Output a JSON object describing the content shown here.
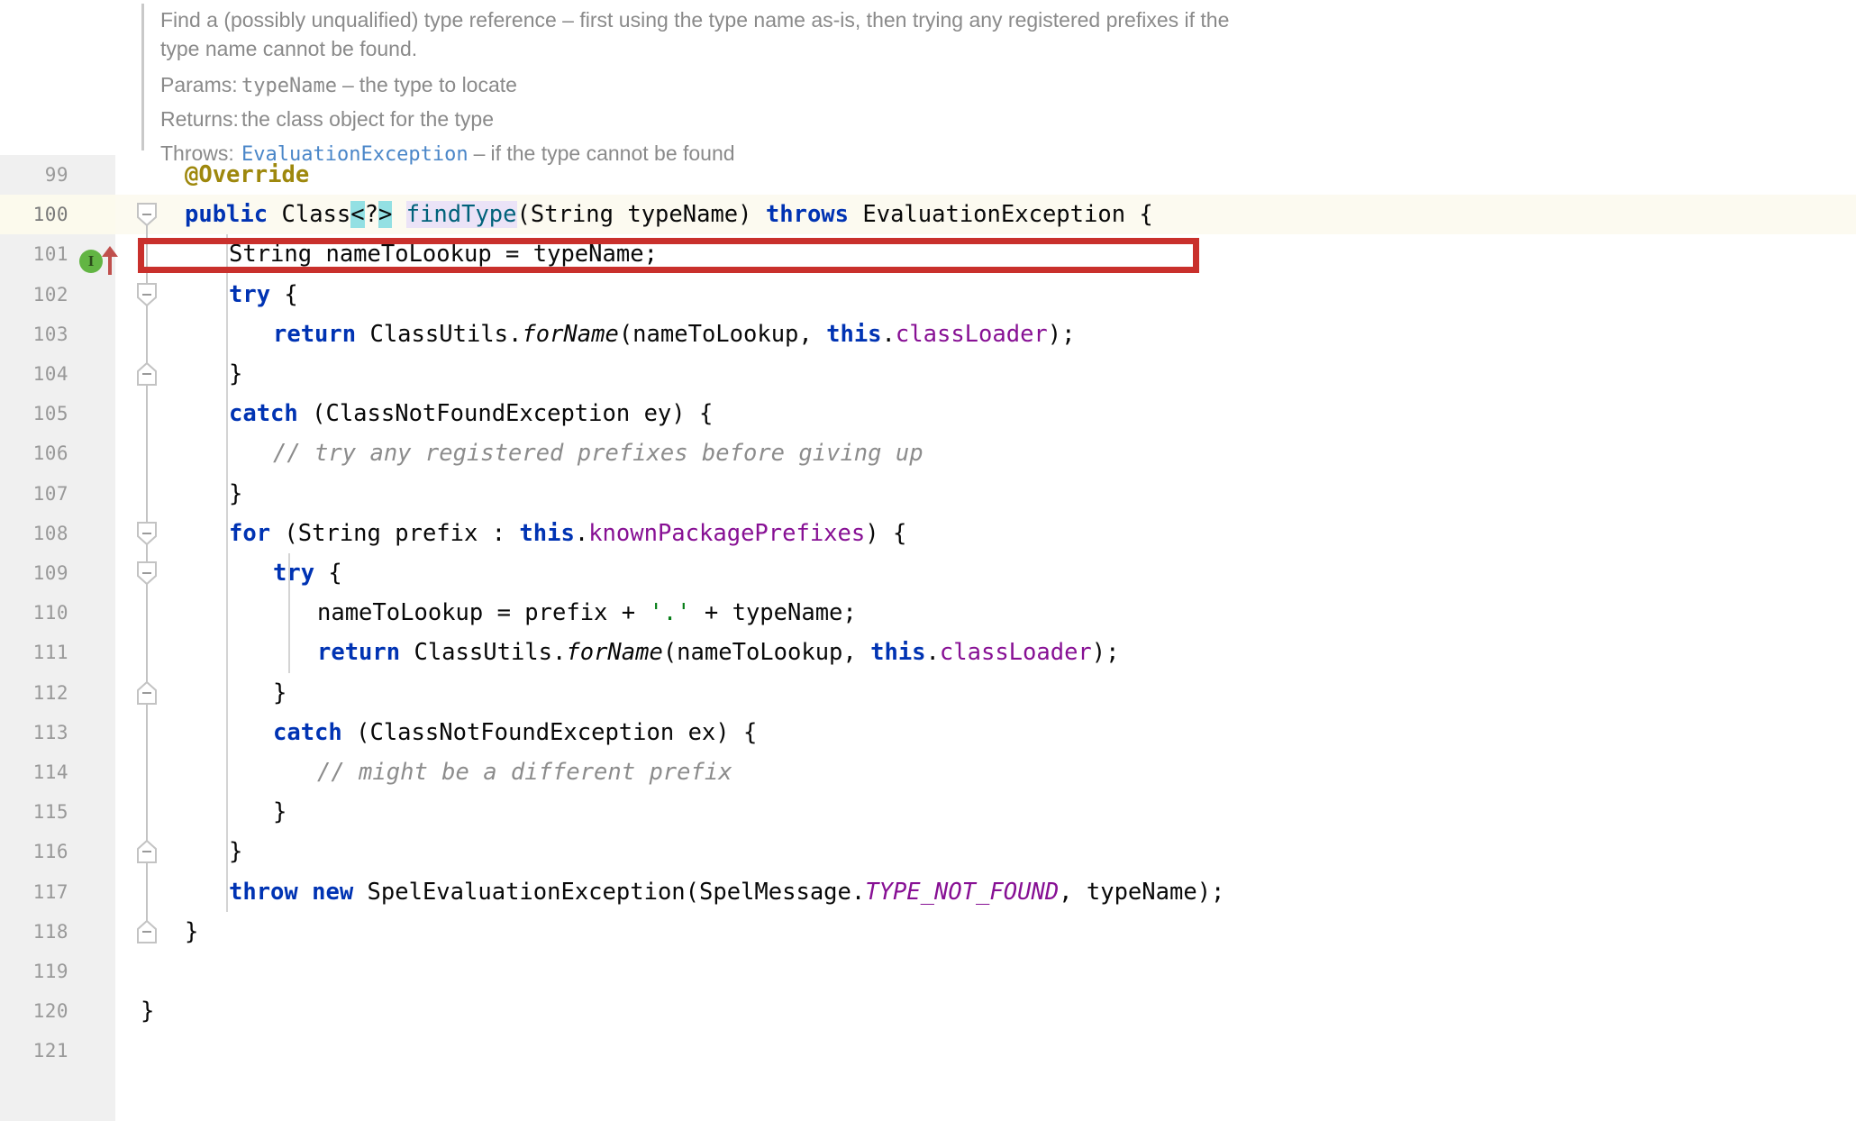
{
  "editor": {
    "language": "java",
    "font_size_px": 25.5,
    "colors": {
      "gutter_bg": "#f0f0f0",
      "editor_bg": "#ffffff",
      "caret_line_bg": "#fcfaf0",
      "keyword": "#0033b3",
      "annotation": "#9e880d",
      "field": "#871094",
      "static_field": "#871094",
      "method_decl": "#00627a",
      "string": "#067d17",
      "comment": "#8c8c8c",
      "identifier_highlight": "#ebe3f7",
      "brace_match_highlight": "#93e0e3",
      "annotation_box_border": "#c9302c",
      "javadoc_text": "#8a8a8a",
      "javadoc_link": "#4a86c8",
      "override_marker": "#62b543",
      "up_arrow": "#c0504d"
    }
  },
  "javadoc": {
    "description": "Find a (possibly unqualified) type reference – first using the type name as-is, then trying any registered prefixes if the type name cannot be found.",
    "params_label": "Params:",
    "param_name": "typeName",
    "param_dash": "–",
    "param_desc": "the type to locate",
    "returns_label": "Returns:",
    "returns_desc": "the class object for the type",
    "throws_label": "Throws:",
    "throws_type": "EvaluationException",
    "throws_dash": "–",
    "throws_desc": "if the type cannot be found"
  },
  "gutter": {
    "markers": {
      "override_icon_letter": "I",
      "override_icon_name": "implementing-method-marker",
      "up_arrow_name": "method-up-arrow-marker"
    }
  },
  "annotation_box": {
    "target_line": "100",
    "label": "highlighted-method-signature"
  },
  "code_lines": [
    {
      "num": "99",
      "indent": 1,
      "tokens": [
        {
          "t": "@Override",
          "c": "anno"
        }
      ]
    },
    {
      "num": "100",
      "indent": 1,
      "caret": true,
      "tokens": [
        {
          "t": "public",
          "c": "kw"
        },
        {
          "t": " ",
          "c": "plain"
        },
        {
          "t": "Class",
          "c": "plain"
        },
        {
          "t": "<",
          "c": "brace-hl"
        },
        {
          "t": "?",
          "c": "plain"
        },
        {
          "t": ">",
          "c": "brace-hl"
        },
        {
          "t": " ",
          "c": "plain"
        },
        {
          "t": "findType",
          "c": "method-i ident-hl"
        },
        {
          "t": "(",
          "c": "plain"
        },
        {
          "t": "String typeName",
          "c": "plain"
        },
        {
          "t": ") ",
          "c": "plain"
        },
        {
          "t": "throws",
          "c": "kw"
        },
        {
          "t": " EvaluationException {",
          "c": "plain"
        }
      ]
    },
    {
      "num": "101",
      "indent": 2,
      "tokens": [
        {
          "t": "String nameToLookup = typeName;",
          "c": "plain"
        }
      ]
    },
    {
      "num": "102",
      "indent": 2,
      "tokens": [
        {
          "t": "try",
          "c": "kw"
        },
        {
          "t": " {",
          "c": "plain"
        }
      ]
    },
    {
      "num": "103",
      "indent": 3,
      "tokens": [
        {
          "t": "return",
          "c": "kw"
        },
        {
          "t": " ClassUtils.",
          "c": "plain"
        },
        {
          "t": "forName",
          "c": "static-m"
        },
        {
          "t": "(nameToLookup, ",
          "c": "plain"
        },
        {
          "t": "this",
          "c": "kw"
        },
        {
          "t": ".",
          "c": "plain"
        },
        {
          "t": "classLoader",
          "c": "field"
        },
        {
          "t": ");",
          "c": "plain"
        }
      ]
    },
    {
      "num": "104",
      "indent": 2,
      "tokens": [
        {
          "t": "}",
          "c": "plain"
        }
      ]
    },
    {
      "num": "105",
      "indent": 2,
      "tokens": [
        {
          "t": "catch",
          "c": "kw"
        },
        {
          "t": " (ClassNotFoundException ey) {",
          "c": "plain"
        }
      ]
    },
    {
      "num": "106",
      "indent": 3,
      "tokens": [
        {
          "t": "// try any registered prefixes before giving up",
          "c": "cmt"
        }
      ]
    },
    {
      "num": "107",
      "indent": 2,
      "tokens": [
        {
          "t": "}",
          "c": "plain"
        }
      ]
    },
    {
      "num": "108",
      "indent": 2,
      "tokens": [
        {
          "t": "for",
          "c": "kw"
        },
        {
          "t": " (String prefix : ",
          "c": "plain"
        },
        {
          "t": "this",
          "c": "kw"
        },
        {
          "t": ".",
          "c": "plain"
        },
        {
          "t": "knownPackagePrefixes",
          "c": "field"
        },
        {
          "t": ") {",
          "c": "plain"
        }
      ]
    },
    {
      "num": "109",
      "indent": 3,
      "tokens": [
        {
          "t": "try",
          "c": "kw"
        },
        {
          "t": " {",
          "c": "plain"
        }
      ]
    },
    {
      "num": "110",
      "indent": 4,
      "tokens": [
        {
          "t": "nameToLookup = prefix + ",
          "c": "plain"
        },
        {
          "t": "'.'",
          "c": "str"
        },
        {
          "t": " + typeName;",
          "c": "plain"
        }
      ]
    },
    {
      "num": "111",
      "indent": 4,
      "tokens": [
        {
          "t": "return",
          "c": "kw"
        },
        {
          "t": " ClassUtils.",
          "c": "plain"
        },
        {
          "t": "forName",
          "c": "static-m"
        },
        {
          "t": "(nameToLookup, ",
          "c": "plain"
        },
        {
          "t": "this",
          "c": "kw"
        },
        {
          "t": ".",
          "c": "plain"
        },
        {
          "t": "classLoader",
          "c": "field"
        },
        {
          "t": ");",
          "c": "plain"
        }
      ]
    },
    {
      "num": "112",
      "indent": 3,
      "tokens": [
        {
          "t": "}",
          "c": "plain"
        }
      ]
    },
    {
      "num": "113",
      "indent": 3,
      "tokens": [
        {
          "t": "catch",
          "c": "kw"
        },
        {
          "t": " (ClassNotFoundException ex) {",
          "c": "plain"
        }
      ]
    },
    {
      "num": "114",
      "indent": 4,
      "tokens": [
        {
          "t": "// might be a different prefix",
          "c": "cmt"
        }
      ]
    },
    {
      "num": "115",
      "indent": 3,
      "tokens": [
        {
          "t": "}",
          "c": "plain"
        }
      ]
    },
    {
      "num": "116",
      "indent": 2,
      "tokens": [
        {
          "t": "}",
          "c": "plain"
        }
      ]
    },
    {
      "num": "117",
      "indent": 2,
      "tokens": [
        {
          "t": "throw",
          "c": "kw"
        },
        {
          "t": " ",
          "c": "plain"
        },
        {
          "t": "new",
          "c": "kw"
        },
        {
          "t": " SpelEvaluationException(SpelMessage.",
          "c": "plain"
        },
        {
          "t": "TYPE_NOT_FOUND",
          "c": "static-f"
        },
        {
          "t": ", typeName);",
          "c": "plain"
        }
      ]
    },
    {
      "num": "118",
      "indent": 1,
      "tokens": [
        {
          "t": "}",
          "c": "plain"
        }
      ]
    },
    {
      "num": "119",
      "indent": 0,
      "tokens": []
    },
    {
      "num": "120",
      "indent": 0,
      "tokens": [
        {
          "t": "}",
          "c": "plain"
        }
      ]
    },
    {
      "num": "121",
      "indent": 0,
      "tokens": []
    }
  ],
  "fold_markers": [
    {
      "line": "100",
      "type": "expanded-open"
    },
    {
      "line": "102",
      "type": "expanded-open"
    },
    {
      "line": "104",
      "type": "expanded-close"
    },
    {
      "line": "108",
      "type": "expanded-open"
    },
    {
      "line": "109",
      "type": "expanded-open"
    },
    {
      "line": "112",
      "type": "expanded-close"
    },
    {
      "line": "116",
      "type": "expanded-close"
    },
    {
      "line": "118",
      "type": "expanded-close"
    }
  ]
}
